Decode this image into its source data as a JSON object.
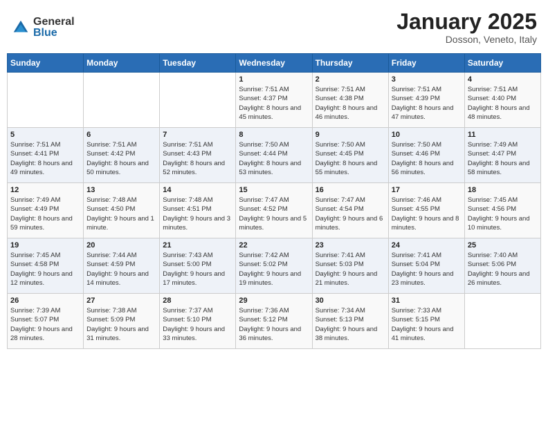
{
  "logo": {
    "general": "General",
    "blue": "Blue"
  },
  "header": {
    "month_year": "January 2025",
    "location": "Dosson, Veneto, Italy"
  },
  "weekdays": [
    "Sunday",
    "Monday",
    "Tuesday",
    "Wednesday",
    "Thursday",
    "Friday",
    "Saturday"
  ],
  "weeks": [
    [
      {
        "day": "",
        "info": ""
      },
      {
        "day": "",
        "info": ""
      },
      {
        "day": "",
        "info": ""
      },
      {
        "day": "1",
        "sunrise": "7:51 AM",
        "sunset": "4:37 PM",
        "daylight": "8 hours and 45 minutes."
      },
      {
        "day": "2",
        "sunrise": "7:51 AM",
        "sunset": "4:38 PM",
        "daylight": "8 hours and 46 minutes."
      },
      {
        "day": "3",
        "sunrise": "7:51 AM",
        "sunset": "4:39 PM",
        "daylight": "8 hours and 47 minutes."
      },
      {
        "day": "4",
        "sunrise": "7:51 AM",
        "sunset": "4:40 PM",
        "daylight": "8 hours and 48 minutes."
      }
    ],
    [
      {
        "day": "5",
        "sunrise": "7:51 AM",
        "sunset": "4:41 PM",
        "daylight": "8 hours and 49 minutes."
      },
      {
        "day": "6",
        "sunrise": "7:51 AM",
        "sunset": "4:42 PM",
        "daylight": "8 hours and 50 minutes."
      },
      {
        "day": "7",
        "sunrise": "7:51 AM",
        "sunset": "4:43 PM",
        "daylight": "8 hours and 52 minutes."
      },
      {
        "day": "8",
        "sunrise": "7:50 AM",
        "sunset": "4:44 PM",
        "daylight": "8 hours and 53 minutes."
      },
      {
        "day": "9",
        "sunrise": "7:50 AM",
        "sunset": "4:45 PM",
        "daylight": "8 hours and 55 minutes."
      },
      {
        "day": "10",
        "sunrise": "7:50 AM",
        "sunset": "4:46 PM",
        "daylight": "8 hours and 56 minutes."
      },
      {
        "day": "11",
        "sunrise": "7:49 AM",
        "sunset": "4:47 PM",
        "daylight": "8 hours and 58 minutes."
      }
    ],
    [
      {
        "day": "12",
        "sunrise": "7:49 AM",
        "sunset": "4:49 PM",
        "daylight": "8 hours and 59 minutes."
      },
      {
        "day": "13",
        "sunrise": "7:48 AM",
        "sunset": "4:50 PM",
        "daylight": "9 hours and 1 minute."
      },
      {
        "day": "14",
        "sunrise": "7:48 AM",
        "sunset": "4:51 PM",
        "daylight": "9 hours and 3 minutes."
      },
      {
        "day": "15",
        "sunrise": "7:47 AM",
        "sunset": "4:52 PM",
        "daylight": "9 hours and 5 minutes."
      },
      {
        "day": "16",
        "sunrise": "7:47 AM",
        "sunset": "4:54 PM",
        "daylight": "9 hours and 6 minutes."
      },
      {
        "day": "17",
        "sunrise": "7:46 AM",
        "sunset": "4:55 PM",
        "daylight": "9 hours and 8 minutes."
      },
      {
        "day": "18",
        "sunrise": "7:45 AM",
        "sunset": "4:56 PM",
        "daylight": "9 hours and 10 minutes."
      }
    ],
    [
      {
        "day": "19",
        "sunrise": "7:45 AM",
        "sunset": "4:58 PM",
        "daylight": "9 hours and 12 minutes."
      },
      {
        "day": "20",
        "sunrise": "7:44 AM",
        "sunset": "4:59 PM",
        "daylight": "9 hours and 14 minutes."
      },
      {
        "day": "21",
        "sunrise": "7:43 AM",
        "sunset": "5:00 PM",
        "daylight": "9 hours and 17 minutes."
      },
      {
        "day": "22",
        "sunrise": "7:42 AM",
        "sunset": "5:02 PM",
        "daylight": "9 hours and 19 minutes."
      },
      {
        "day": "23",
        "sunrise": "7:41 AM",
        "sunset": "5:03 PM",
        "daylight": "9 hours and 21 minutes."
      },
      {
        "day": "24",
        "sunrise": "7:41 AM",
        "sunset": "5:04 PM",
        "daylight": "9 hours and 23 minutes."
      },
      {
        "day": "25",
        "sunrise": "7:40 AM",
        "sunset": "5:06 PM",
        "daylight": "9 hours and 26 minutes."
      }
    ],
    [
      {
        "day": "26",
        "sunrise": "7:39 AM",
        "sunset": "5:07 PM",
        "daylight": "9 hours and 28 minutes."
      },
      {
        "day": "27",
        "sunrise": "7:38 AM",
        "sunset": "5:09 PM",
        "daylight": "9 hours and 31 minutes."
      },
      {
        "day": "28",
        "sunrise": "7:37 AM",
        "sunset": "5:10 PM",
        "daylight": "9 hours and 33 minutes."
      },
      {
        "day": "29",
        "sunrise": "7:36 AM",
        "sunset": "5:12 PM",
        "daylight": "9 hours and 36 minutes."
      },
      {
        "day": "30",
        "sunrise": "7:34 AM",
        "sunset": "5:13 PM",
        "daylight": "9 hours and 38 minutes."
      },
      {
        "day": "31",
        "sunrise": "7:33 AM",
        "sunset": "5:15 PM",
        "daylight": "9 hours and 41 minutes."
      },
      {
        "day": "",
        "info": ""
      }
    ]
  ],
  "sunrise_label": "Sunrise:",
  "sunset_label": "Sunset:",
  "daylight_label": "Daylight:"
}
